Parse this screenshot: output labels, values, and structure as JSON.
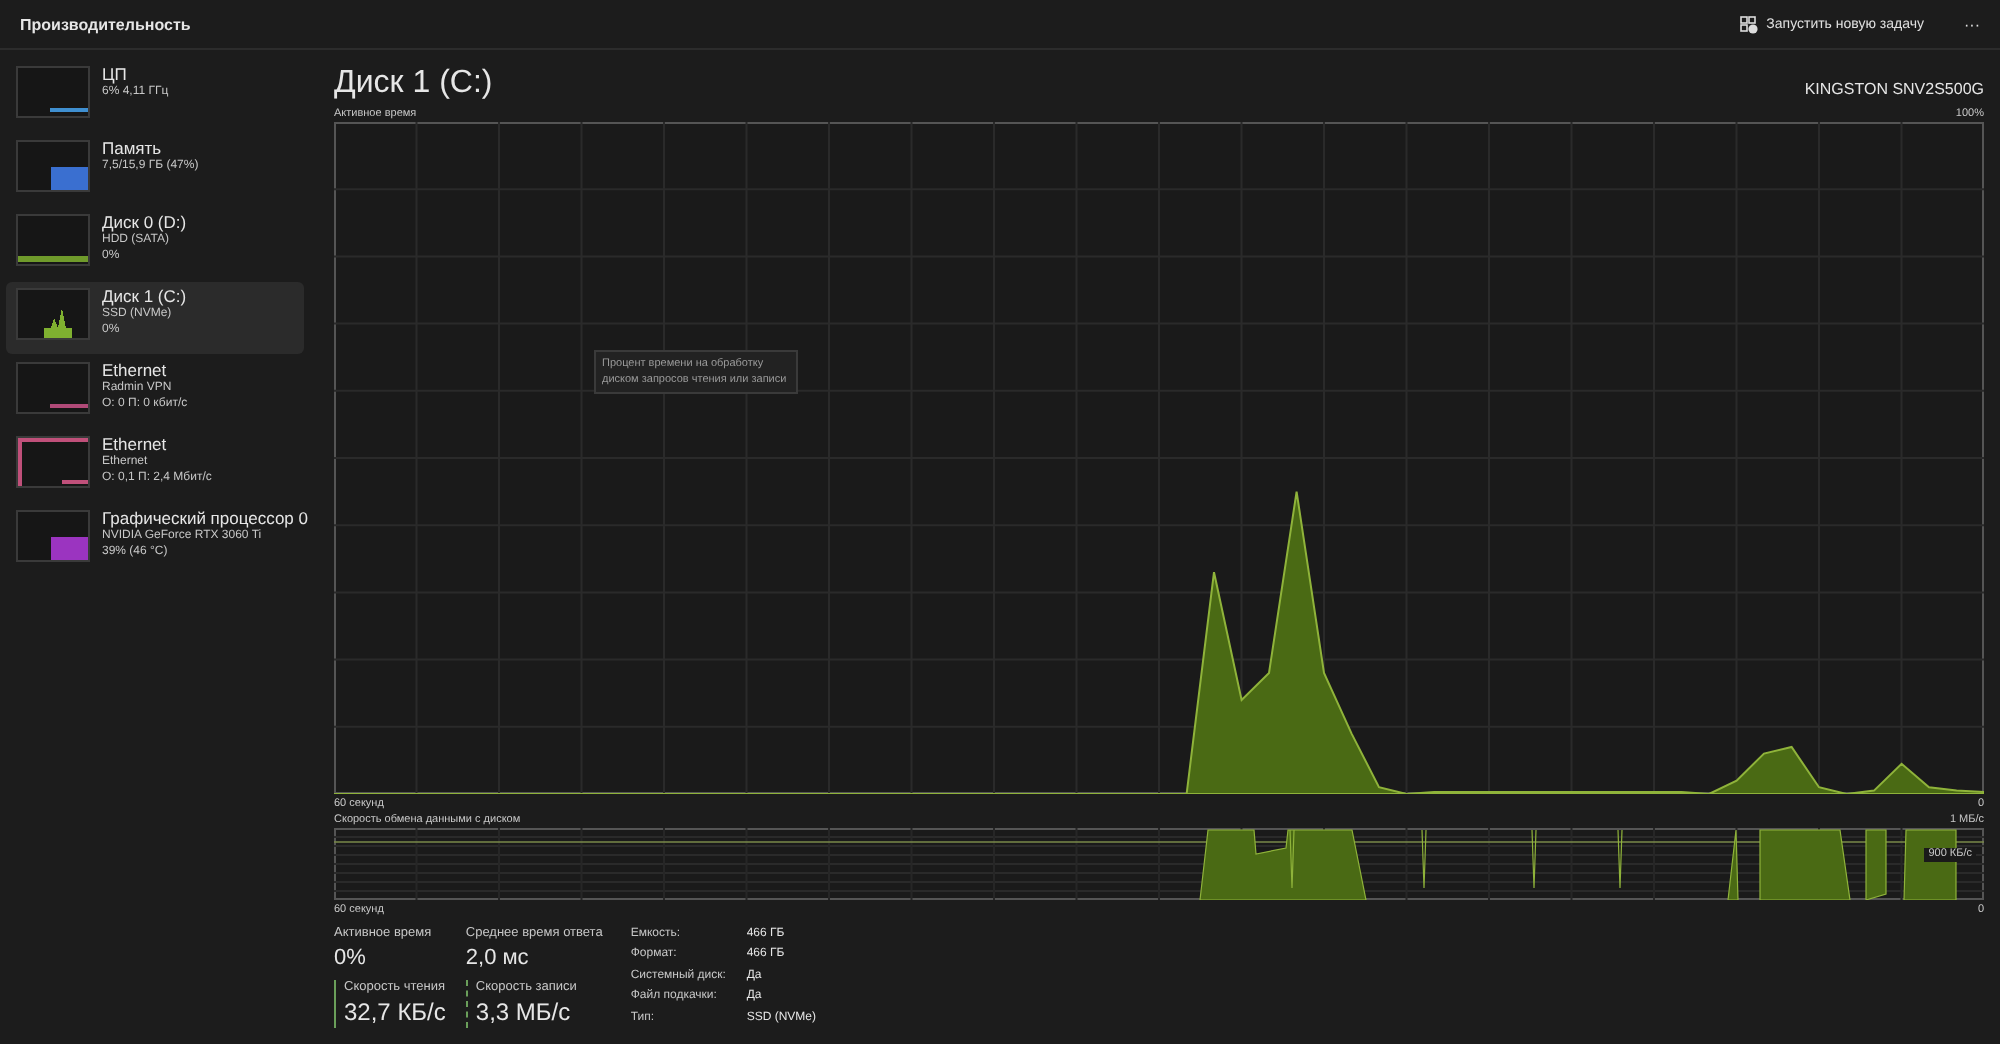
{
  "header": {
    "title": "Производительность",
    "new_task_button": "Запустить новую задачу",
    "more_button": "···"
  },
  "sidebar": {
    "items": [
      {
        "name": "ЦП",
        "lines": [
          "6% 4,11 ГГц"
        ],
        "kind": "line",
        "color": "#3f8fd0",
        "selected": false
      },
      {
        "name": "Память",
        "lines": [
          "7,5/15,9 ГБ (47%)"
        ],
        "kind": "block",
        "color": "#3a6fd0",
        "selected": false
      },
      {
        "name": "Диск 0 (D:)",
        "lines": [
          "HDD (SATA)",
          "0%"
        ],
        "kind": "flat",
        "color": "#6f9a2b",
        "selected": false
      },
      {
        "name": "Диск 1 (C:)",
        "lines": [
          "SSD (NVMe)",
          "0%"
        ],
        "kind": "spike",
        "color": "#7fb030",
        "selected": true
      },
      {
        "name": "Ethernet",
        "lines": [
          "Radmin VPN",
          "О: 0 П: 0 кбит/с"
        ],
        "kind": "line",
        "color": "#b04a78",
        "selected": false
      },
      {
        "name": "Ethernet",
        "lines": [
          "Ethernet",
          "О: 0,1 П: 2,4 Мбит/с"
        ],
        "kind": "top",
        "color": "#c0507a",
        "selected": false
      },
      {
        "name": "Графический процессор 0",
        "lines": [
          "NVIDIA GeForce RTX 3060 Ti",
          "39% (46 °C)"
        ],
        "kind": "block",
        "color": "#9b34c0",
        "selected": false
      }
    ]
  },
  "detail": {
    "title": "Диск 1 (C:)",
    "model": "KINGSTON SNV2S500G",
    "activity_chart": {
      "title": "Активное время",
      "time_label": "60 секунд",
      "max_label": "100%",
      "min_label": "0",
      "tooltip": "Процент времени на обработку диском запросов чтения или записи"
    },
    "transfer_chart": {
      "title": "Скорость обмена данными с диском",
      "max_label": "1 МБ/с",
      "mark_label": "900 КБ/с",
      "time_label": "60 секунд",
      "min_label": "0"
    },
    "stats": [
      {
        "label": "Активное время",
        "value": "0%"
      },
      {
        "label": "Среднее время ответа",
        "value": "2,0 мс"
      }
    ],
    "rates": [
      {
        "label": "Скорость чтения",
        "value": "32,7 КБ/с",
        "kind": "read"
      },
      {
        "label": "Скорость записи",
        "value": "3,3 МБ/с",
        "kind": "write"
      }
    ],
    "properties": [
      {
        "key": "Емкость:",
        "value": "466 ГБ"
      },
      {
        "key": "Формат:",
        "value": "466 ГБ"
      },
      {
        "key": "Системный диск:",
        "value": "Да"
      },
      {
        "key": "Файл подкачки:",
        "value": "Да"
      },
      {
        "key": "Тип:",
        "value": "SSD (NVMe)"
      }
    ]
  }
}
